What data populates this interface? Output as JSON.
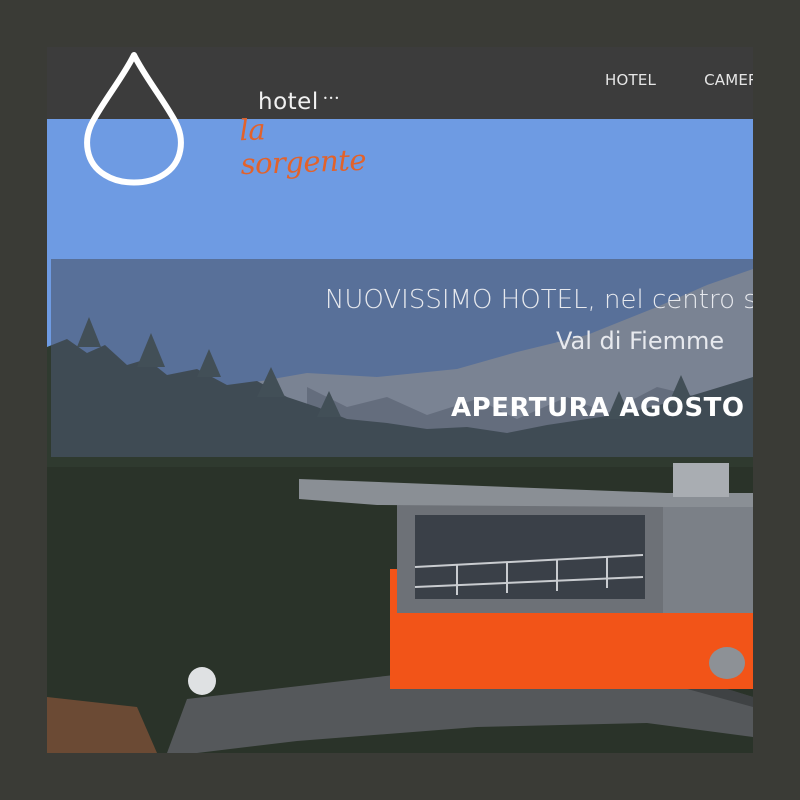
{
  "nav": {
    "items": [
      {
        "label": "HOTEL"
      },
      {
        "label": "CAMERE"
      }
    ]
  },
  "logo": {
    "line1": "hotel",
    "stars": "•••",
    "line2": "la sorgente",
    "accent_color": "#e2622b"
  },
  "hero": {
    "headline": "NUOVISSIMO HOTEL, nel centro storico di",
    "subheadline": "Val di Fiemme",
    "cta": "APERTURA AGOSTO"
  },
  "colors": {
    "frame": "#3a3b36",
    "topbar": "#3c3c3c",
    "sky": "#6e9be3",
    "building_orange": "#f25418"
  }
}
